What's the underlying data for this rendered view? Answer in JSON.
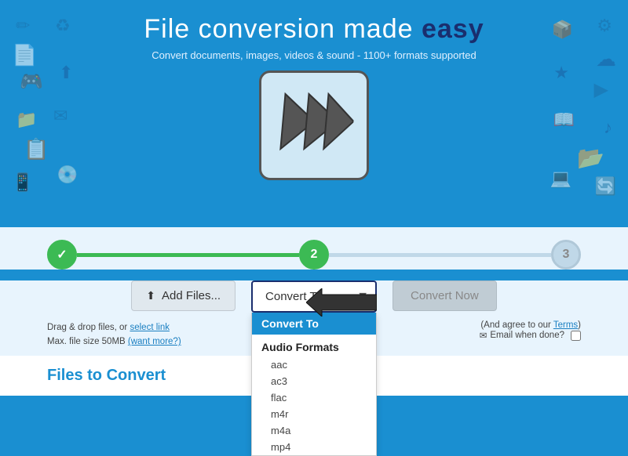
{
  "hero": {
    "title_plain": "File ",
    "title_highlight": "conversion",
    "title_middle": " made ",
    "title_bold": "easy",
    "subtitle": "Convert documents, images, videos & sound - 1100+ formats supported"
  },
  "steps": {
    "step1_done": "✓",
    "step2_label": "2",
    "step3_label": "3"
  },
  "actions": {
    "add_files_label": "Add Files...",
    "convert_to_label": "Convert To",
    "convert_now_label": "Convert Now",
    "convert_now_sub": "(And agree to our Terms)",
    "email_label": "Email when done?",
    "drag_drop_text": "Drag & drop files, or",
    "select_link_text": "select link",
    "max_size_text": "Max. file size 50MB",
    "want_more_text": "(want more?)"
  },
  "dropdown": {
    "header": "Convert To",
    "category": "Audio Formats",
    "items": [
      "aac",
      "ac3",
      "flac",
      "m4r",
      "m4a",
      "mp4"
    ]
  },
  "bottom": {
    "files_label_plain": "Files to ",
    "files_label_highlight": "Convert"
  }
}
